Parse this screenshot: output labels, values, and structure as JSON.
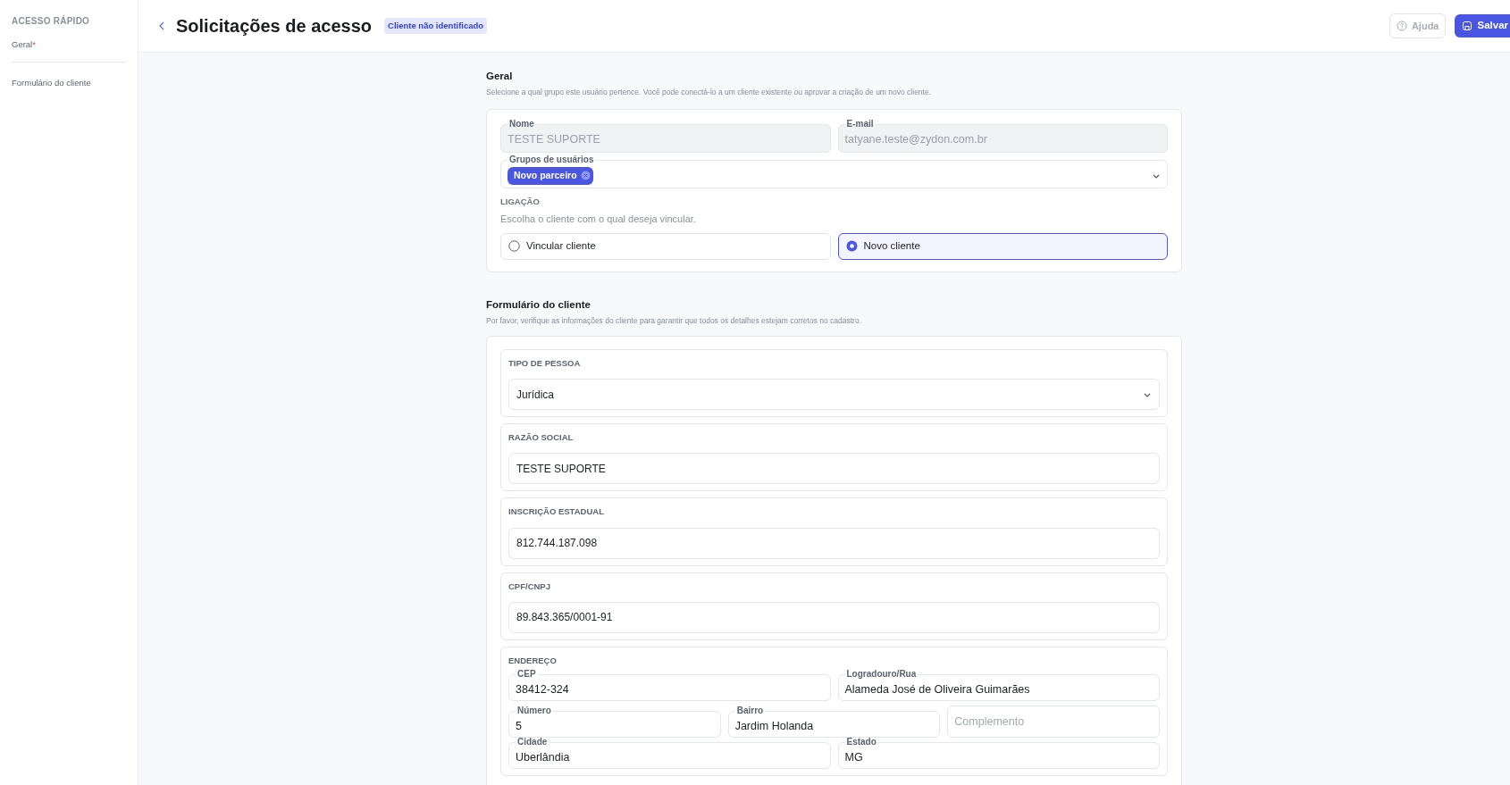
{
  "sidebar": {
    "title": "ACESSO RÁPIDO",
    "items": [
      {
        "label": "Geral",
        "required_mark": "*"
      },
      {
        "label": "Formulário do cliente"
      }
    ]
  },
  "header": {
    "title": "Solicitações de acesso",
    "badge": "Cliente não identificado",
    "buttons": [
      {
        "label": "Ajuda",
        "kind": "help",
        "disabled": true
      },
      {
        "label": "Salvar",
        "kind": "save",
        "disabled": false
      }
    ]
  },
  "general": {
    "title": "Geral",
    "description": "Selecione a qual grupo este usuário pertence. Você pode conectá-lo a um cliente existente ou aprovar a criação de um novo cliente.",
    "fields": [
      {
        "label": "Nome",
        "value": "TESTE SUPORTE",
        "disabled": true
      },
      {
        "label": "E-mail",
        "value": "tatyane.teste@zydon.com.br",
        "disabled": true
      }
    ],
    "user_groups": {
      "label": "Grupos de usuários",
      "tags": [
        "Novo parceiro"
      ]
    },
    "link": {
      "title": "LIGAÇÃO",
      "description": "Escolha o cliente com o qual deseja vincular.",
      "options": [
        {
          "label": "Vincular cliente",
          "selected": false
        },
        {
          "label": "Novo cliente",
          "selected": true
        }
      ]
    }
  },
  "client_form": {
    "title": "Formulário do cliente",
    "description": "Por favor, verifique as informações do cliente para garantir que todos os detalhes estejam corretos no cadastro.",
    "groups": [
      {
        "title": "TIPO DE PESSOA",
        "kind": "select",
        "value": "Jurídica"
      },
      {
        "title": "RAZÃO SOCIAL",
        "kind": "input",
        "value": "TESTE SUPORTE"
      },
      {
        "title": "INSCRIÇÃO ESTADUAL",
        "kind": "input",
        "value": "812.744.187.098"
      },
      {
        "title": "CPF/CNPJ",
        "kind": "input",
        "value": "89.843.365/0001-91"
      },
      {
        "title": "ENDEREÇO",
        "kind": "address",
        "rows": [
          [
            {
              "label": "CEP",
              "value": "38412-324"
            },
            {
              "label": "Logradouro/Rua",
              "value": "Alameda José de Oliveira Guimarães"
            }
          ],
          [
            {
              "label": "Número",
              "value": "5"
            },
            {
              "label": "Bairro",
              "value": "Jardim Holanda"
            },
            {
              "placeholder": "Complemento"
            }
          ],
          [
            {
              "label": "Cidade",
              "value": "Uberlândia"
            },
            {
              "label": "Estado",
              "value": "MG"
            }
          ]
        ]
      }
    ]
  }
}
